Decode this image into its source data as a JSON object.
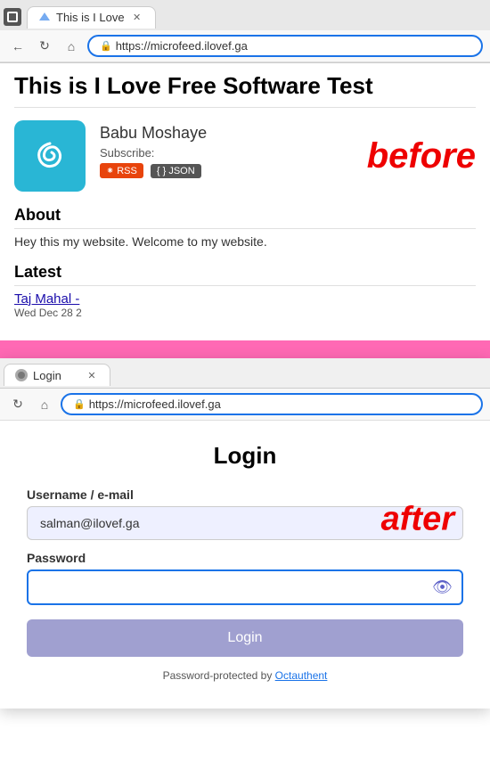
{
  "browser_top": {
    "tab_title": "This is I Love",
    "url": "https://microfeed.ilovef.ga"
  },
  "page": {
    "site_title": "This is I Love Free Software Test",
    "profile": {
      "name": "Babu Moshaye",
      "subscribe_label": "Subscribe:",
      "rss_label": "RSS",
      "json_label": "JSON",
      "before_label": "before"
    },
    "about": {
      "heading": "About",
      "text": "Hey this my website. Welcome to my website."
    },
    "latest": {
      "heading": "Latest",
      "article_title": "Taj Mahal -",
      "article_date": "Wed Dec 28 2"
    }
  },
  "login_browser": {
    "tab_title": "Login",
    "url": "https://microfeed.ilovef.ga"
  },
  "login_form": {
    "title": "Login",
    "username_label": "Username / e-mail",
    "username_value": "salman@ilovef.ga",
    "password_label": "Password",
    "password_value": "",
    "after_label": "after",
    "login_button": "Login",
    "footer_text": "Password-protected by ",
    "footer_link": "Octauthent"
  },
  "icons": {
    "back": "←",
    "reload": "↻",
    "home": "⌂",
    "lock": "🔒",
    "close": "✕",
    "eye": "👁"
  }
}
